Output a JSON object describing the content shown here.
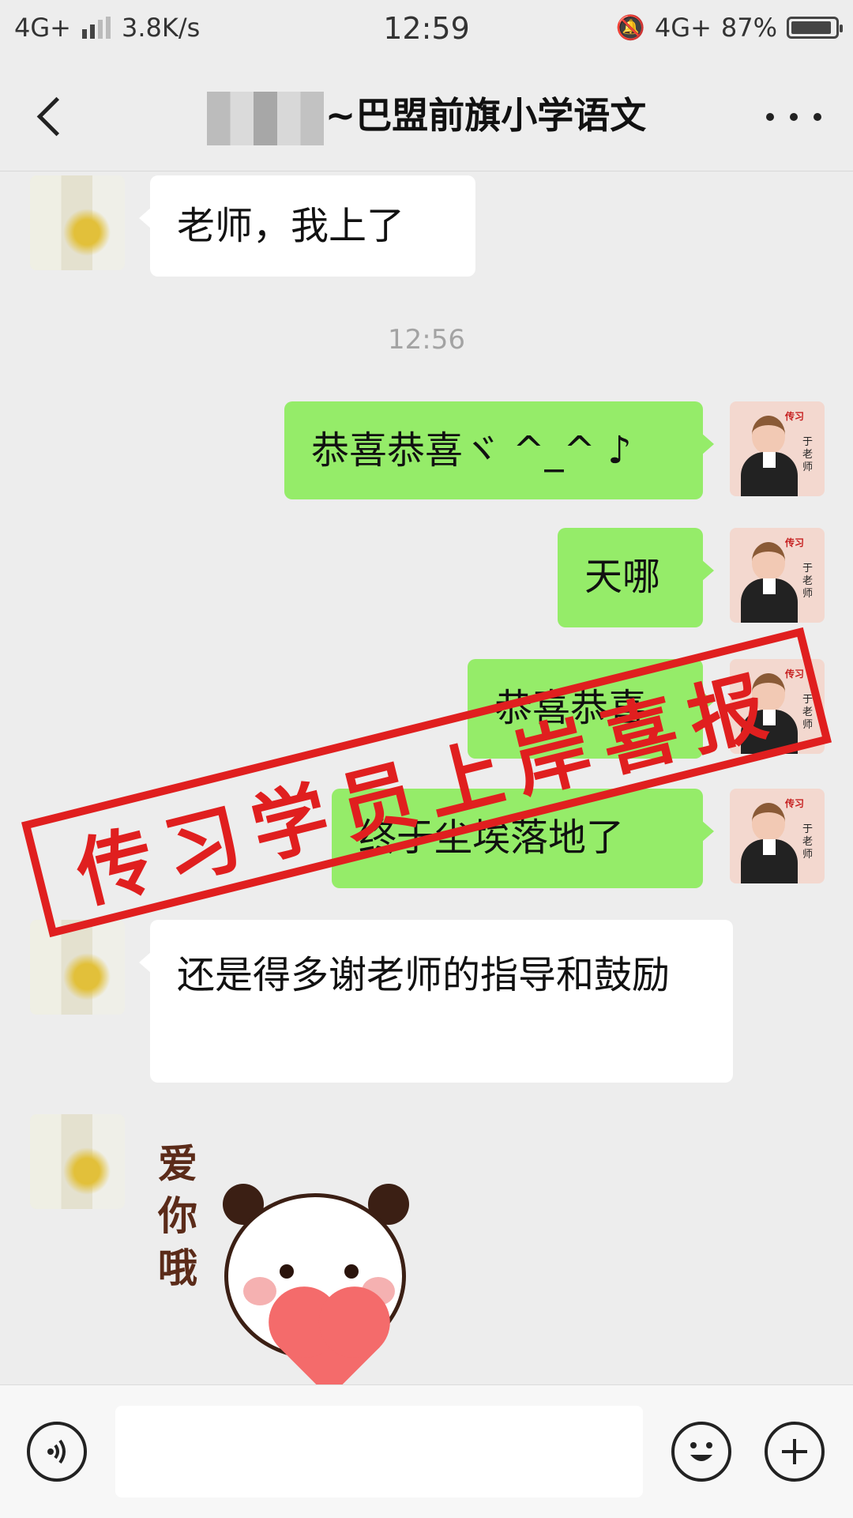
{
  "status_bar": {
    "network_left": "4G+",
    "speed": "3.8K/s",
    "time": "12:59",
    "network_right": "4G+",
    "battery": "87%"
  },
  "header": {
    "title": "~巴盟前旗小学语文"
  },
  "chat": {
    "timestamp": "12:56",
    "messages": [
      {
        "side": "left",
        "text": "老师，我上了"
      },
      {
        "side": "right",
        "text": "恭喜恭喜ヾ ^_^ ♪"
      },
      {
        "side": "right",
        "text": "天哪"
      },
      {
        "side": "right",
        "text": "恭喜恭喜"
      },
      {
        "side": "right",
        "text": "终于尘埃落地了"
      },
      {
        "side": "left",
        "text": "还是得多谢老师的指导和鼓励"
      }
    ],
    "sticker_text": "爱你哦"
  },
  "teacher_avatar": {
    "tag": "传习",
    "name": "于老师"
  },
  "overlay_stamp": "传习学员上岸喜报",
  "icons": {
    "back": "back-icon",
    "more": "more-icon",
    "voice": "voice-icon",
    "emoji": "emoji-icon",
    "add": "add-icon"
  },
  "colors": {
    "green_bubble": "#95ec69",
    "stamp_red": "#e01f1f"
  }
}
